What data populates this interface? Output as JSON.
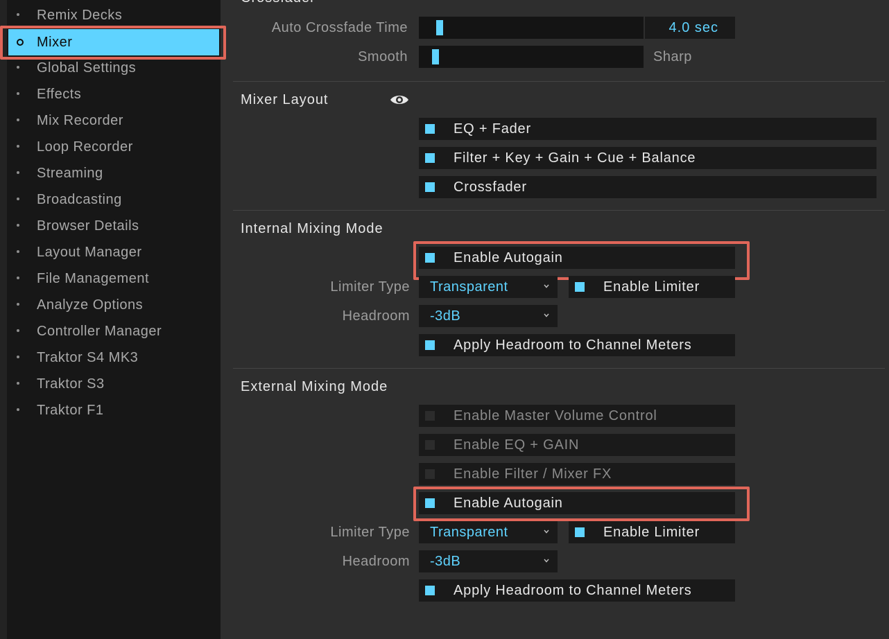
{
  "sidebar": {
    "items": [
      {
        "label": "Remix Decks",
        "selected": false
      },
      {
        "label": "Mixer",
        "selected": true
      },
      {
        "label": "Global Settings",
        "selected": false
      },
      {
        "label": "Effects",
        "selected": false
      },
      {
        "label": "Mix Recorder",
        "selected": false
      },
      {
        "label": "Loop Recorder",
        "selected": false
      },
      {
        "label": "Streaming",
        "selected": false
      },
      {
        "label": "Broadcasting",
        "selected": false
      },
      {
        "label": "Browser Details",
        "selected": false
      },
      {
        "label": "Layout Manager",
        "selected": false
      },
      {
        "label": "File Management",
        "selected": false
      },
      {
        "label": "Analyze Options",
        "selected": false
      },
      {
        "label": "Controller Manager",
        "selected": false
      },
      {
        "label": "Traktor S4 MK3",
        "selected": false
      },
      {
        "label": "Traktor S3",
        "selected": false
      },
      {
        "label": "Traktor F1",
        "selected": false
      }
    ]
  },
  "crossfader": {
    "title": "Crossfader",
    "auto_crossfade_label": "Auto Crossfade Time",
    "auto_crossfade_value": "4.0 sec",
    "auto_crossfade_level": 0.03,
    "smooth_label": "Smooth",
    "sharp_label": "Sharp",
    "curve_level": 0.01
  },
  "mixer_layout": {
    "title": "Mixer Layout",
    "visibility_icon": "eye-icon",
    "options": [
      {
        "label": "EQ + Fader",
        "checked": true
      },
      {
        "label": "Filter + Key + Gain + Cue + Balance",
        "checked": true
      },
      {
        "label": "Crossfader",
        "checked": true
      }
    ]
  },
  "internal": {
    "title": "Internal Mixing Mode",
    "autogain_label": "Enable Autogain",
    "autogain_checked": true,
    "limiter_type_label": "Limiter Type",
    "limiter_type_value": "Transparent",
    "enable_limiter_label": "Enable Limiter",
    "enable_limiter_checked": true,
    "headroom_label": "Headroom",
    "headroom_value": "-3dB",
    "apply_headroom_label": "Apply Headroom to Channel Meters",
    "apply_headroom_checked": true
  },
  "external": {
    "title": "External Mixing Mode",
    "master_volume_label": "Enable Master Volume Control",
    "eq_gain_label": "Enable EQ + GAIN",
    "filter_fx_label": "Enable Filter / Mixer FX",
    "autogain_label": "Enable Autogain",
    "autogain_checked": true,
    "limiter_type_label": "Limiter Type",
    "limiter_type_value": "Transparent",
    "enable_limiter_label": "Enable Limiter",
    "enable_limiter_checked": true,
    "headroom_label": "Headroom",
    "headroom_value": "-3dB",
    "apply_headroom_label": "Apply Headroom to Channel Meters",
    "apply_headroom_checked": true
  },
  "colors": {
    "accent": "#5fd3ff",
    "highlight": "#e06659",
    "panel": "#2e2e2e",
    "sidebar": "#171717"
  }
}
